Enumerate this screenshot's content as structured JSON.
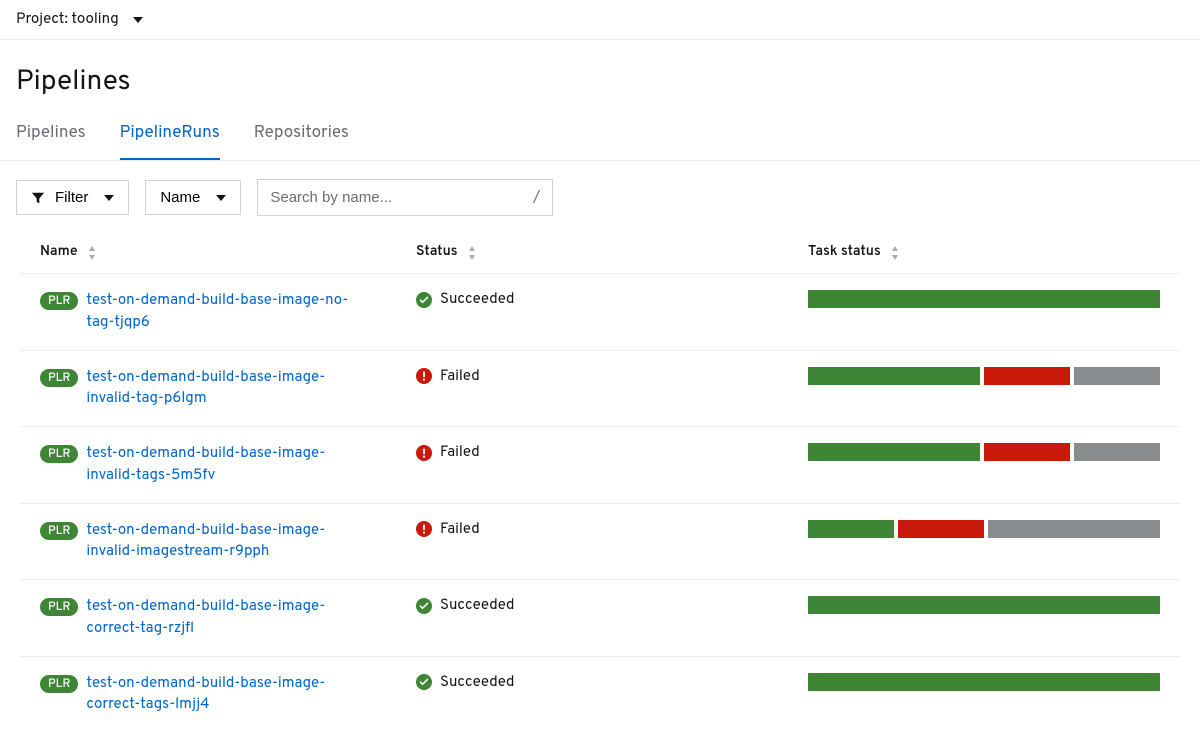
{
  "project_prefix": "Project: ",
  "project_name": "tooling",
  "page_title": "Pipelines",
  "tabs": [
    "Pipelines",
    "PipelineRuns",
    "Repositories"
  ],
  "active_tab_index": 1,
  "toolbar": {
    "filter_label": "Filter",
    "attribute_label": "Name",
    "search_placeholder": "Search by name...",
    "shortcut_hint": "/"
  },
  "columns": [
    "Name",
    "Status",
    "Task status"
  ],
  "badge_label": "PLR",
  "status_labels": {
    "succeeded": "Succeeded",
    "failed": "Failed"
  },
  "colors": {
    "success_green": "#3e8635",
    "fail_red": "#c9190b",
    "grey": "#8a8d90",
    "link_blue": "#0066cc"
  },
  "rows": [
    {
      "name": "test-on-demand-build-base-image-no-tag-tjqp6",
      "status": "succeeded",
      "segments": [
        {
          "color": "green",
          "pct": 100
        }
      ]
    },
    {
      "name": "test-on-demand-build-base-image-invalid-tag-p6lgm",
      "status": "failed",
      "segments": [
        {
          "color": "green",
          "pct": 50
        },
        {
          "color": "red",
          "pct": 25
        },
        {
          "color": "grey",
          "pct": 25
        }
      ]
    },
    {
      "name": "test-on-demand-build-base-image-invalid-tags-5m5fv",
      "status": "failed",
      "segments": [
        {
          "color": "green",
          "pct": 50
        },
        {
          "color": "red",
          "pct": 25
        },
        {
          "color": "grey",
          "pct": 25
        }
      ]
    },
    {
      "name": "test-on-demand-build-base-image-invalid-imagestream-r9pph",
      "status": "failed",
      "segments": [
        {
          "color": "green",
          "pct": 25
        },
        {
          "color": "red",
          "pct": 25
        },
        {
          "color": "grey",
          "pct": 50
        }
      ]
    },
    {
      "name": "test-on-demand-build-base-image-correct-tag-rzjfl",
      "status": "succeeded",
      "segments": [
        {
          "color": "green",
          "pct": 100
        }
      ]
    },
    {
      "name": "test-on-demand-build-base-image-correct-tags-lmjj4",
      "status": "succeeded",
      "segments": [
        {
          "color": "green",
          "pct": 100
        }
      ]
    }
  ]
}
